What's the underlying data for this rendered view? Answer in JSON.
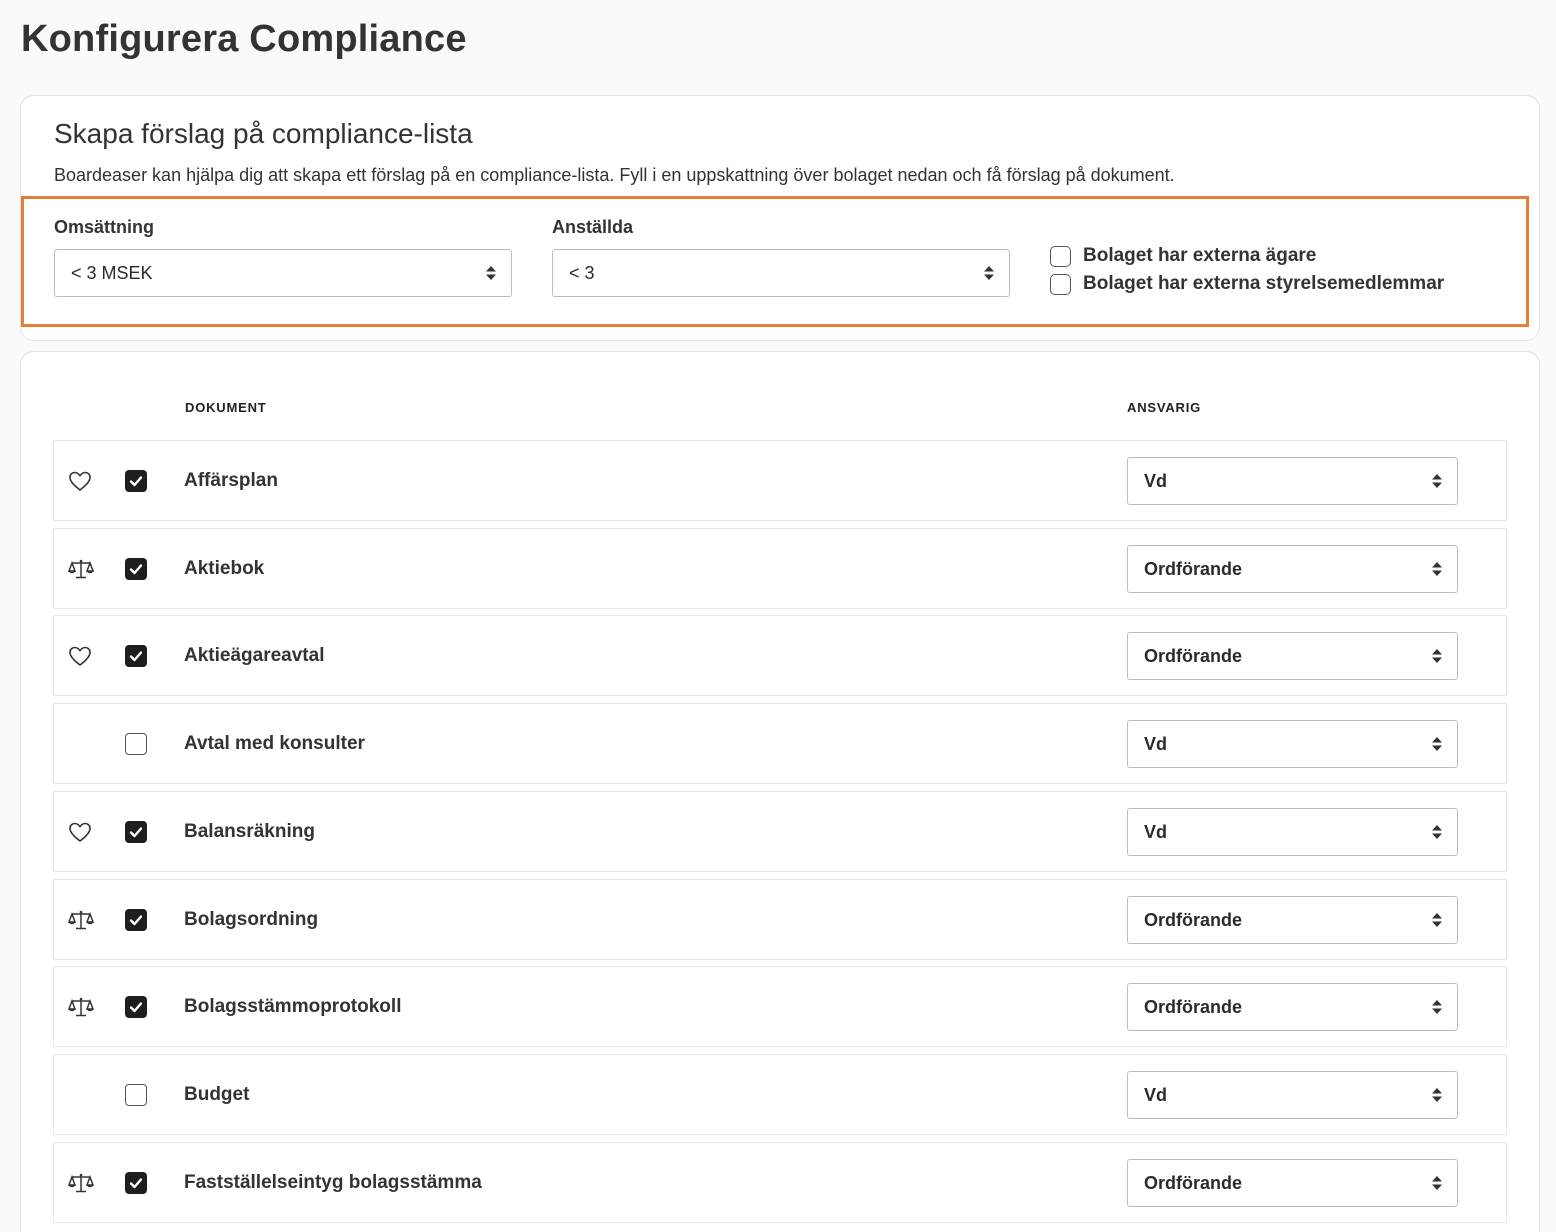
{
  "page": {
    "title": "Konfigurera Compliance"
  },
  "suggest": {
    "title": "Skapa förslag på compliance-lista",
    "description": "Boardeaser kan hjälpa dig att skapa ett förslag på en compliance-lista. Fyll i en uppskattning över bolaget nedan och få förslag på dokument.",
    "revenue": {
      "label": "Omsättning",
      "value": "< 3 MSEK"
    },
    "employees": {
      "label": "Anställda",
      "value": "< 3"
    },
    "external_owners": {
      "label": "Bolaget har externa ägare",
      "checked": false
    },
    "external_board": {
      "label": "Bolaget har externa styrelsemedlemmar",
      "checked": false
    },
    "highlight_color": "#e57f35"
  },
  "table": {
    "headers": {
      "document": "DOKUMENT",
      "responsible": "ANSVARIG"
    },
    "rows": [
      {
        "icon": "heart-icon",
        "checked": true,
        "name": "Affärsplan",
        "responsible": "Vd"
      },
      {
        "icon": "scale-icon",
        "checked": true,
        "name": "Aktiebok",
        "responsible": "Ordförande"
      },
      {
        "icon": "heart-icon",
        "checked": true,
        "name": "Aktieägareavtal",
        "responsible": "Ordförande"
      },
      {
        "icon": "",
        "checked": false,
        "name": "Avtal med konsulter",
        "responsible": "Vd"
      },
      {
        "icon": "heart-icon",
        "checked": true,
        "name": "Balansräkning",
        "responsible": "Vd"
      },
      {
        "icon": "scale-icon",
        "checked": true,
        "name": "Bolagsordning",
        "responsible": "Ordförande"
      },
      {
        "icon": "scale-icon",
        "checked": true,
        "name": "Bolagsstämmoprotokoll",
        "responsible": "Ordförande"
      },
      {
        "icon": "",
        "checked": false,
        "name": "Budget",
        "responsible": "Vd"
      },
      {
        "icon": "scale-icon",
        "checked": true,
        "name": "Fastställelseintyg bolagsstämma",
        "responsible": "Ordförande"
      }
    ]
  }
}
